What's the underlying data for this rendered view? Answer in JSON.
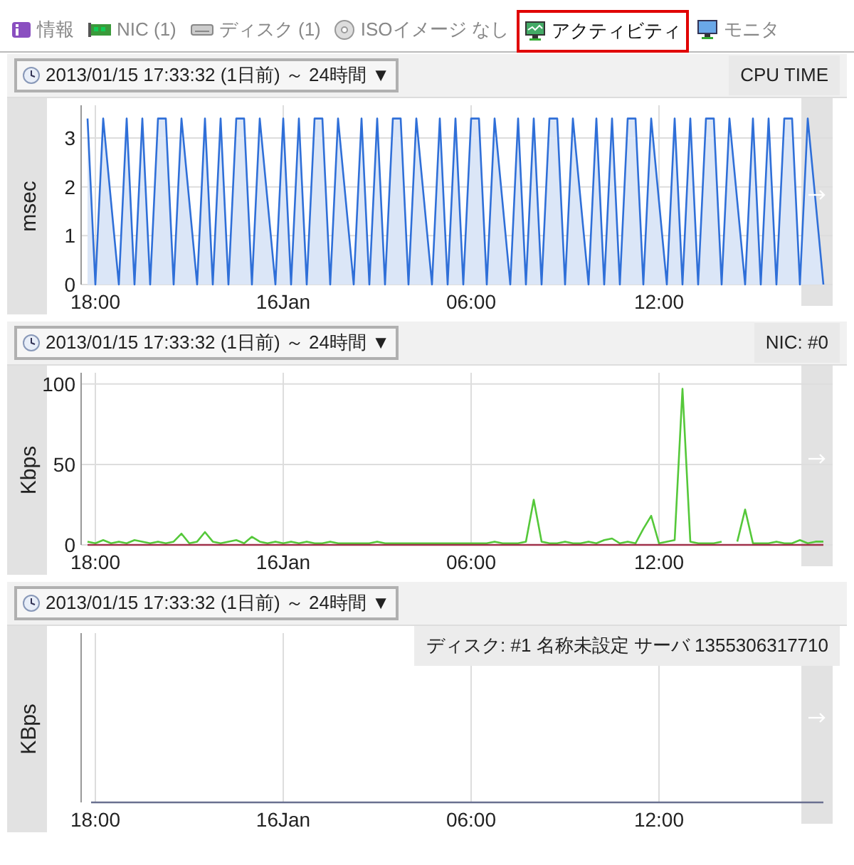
{
  "tabs": [
    {
      "label": "情報",
      "selected": false
    },
    {
      "label": "NIC (1)",
      "selected": false
    },
    {
      "label": "ディスク (1)",
      "selected": false
    },
    {
      "label": "ISOイメージ なし",
      "selected": false
    },
    {
      "label": "アクティビティ",
      "selected": true
    },
    {
      "label": "モニタ",
      "selected": false
    }
  ],
  "panels": [
    {
      "range": "2013/01/15 17:33:32 (1日前) ～ 24時間 ▼",
      "label": "CPU TIME",
      "chart_data": {
        "type": "area",
        "grid": true,
        "ylabel": "msec",
        "ylim": [
          0,
          3.67
        ],
        "yticks": [
          0,
          1,
          2,
          3
        ],
        "categories": [
          null,
          "18:00",
          null,
          null,
          null,
          null,
          null,
          null,
          null,
          null,
          null,
          null,
          null,
          null,
          null,
          null,
          null,
          null,
          null,
          null,
          null,
          null,
          null,
          null,
          null,
          "16Jan",
          null,
          null,
          null,
          null,
          null,
          null,
          null,
          null,
          null,
          null,
          null,
          null,
          null,
          null,
          null,
          null,
          null,
          null,
          null,
          null,
          null,
          null,
          null,
          "06:00",
          null,
          null,
          null,
          null,
          null,
          null,
          null,
          null,
          null,
          null,
          null,
          null,
          null,
          null,
          null,
          null,
          null,
          null,
          null,
          null,
          null,
          null,
          null,
          "12:00",
          null,
          null,
          null,
          null,
          null,
          null,
          null,
          null,
          null,
          null,
          null,
          null,
          null,
          null,
          null,
          null,
          null,
          null,
          null,
          null,
          null
        ],
        "series": [
          {
            "color": "#2f6fd8",
            "values": [
              3.4,
              0,
              3.4,
              1.7,
              0,
              3.4,
              0,
              3.4,
              0,
              3.4,
              3.4,
              0,
              3.4,
              1.7,
              0,
              3.4,
              0,
              3.4,
              0,
              3.4,
              3.4,
              0,
              3.4,
              1.7,
              0,
              3.4,
              0,
              3.4,
              0,
              3.4,
              3.4,
              0,
              3.4,
              1.7,
              0,
              3.4,
              0,
              3.4,
              0,
              3.4,
              3.4,
              0,
              3.4,
              1.7,
              0,
              3.4,
              0,
              3.4,
              0,
              3.4,
              3.4,
              0,
              3.4,
              1.7,
              0,
              3.4,
              0,
              3.4,
              0,
              3.4,
              3.4,
              0,
              3.4,
              1.7,
              0,
              3.4,
              0,
              3.4,
              0,
              3.4,
              3.4,
              0,
              3.4,
              1.7,
              0,
              3.4,
              0,
              3.4,
              0,
              3.4,
              3.4,
              0,
              3.4,
              1.7,
              0,
              3.4,
              0,
              3.4,
              0,
              3.4,
              3.4,
              0,
              3.4,
              1.7,
              0
            ]
          }
        ]
      }
    },
    {
      "range": "2013/01/15 17:33:32 (1日前) ～ 24時間 ▼",
      "label": "NIC: #0",
      "chart_data": {
        "type": "line",
        "grid": true,
        "ylabel": "Kbps",
        "ylim": [
          0,
          107
        ],
        "yticks": [
          0,
          50,
          100
        ],
        "categories": [
          null,
          "18:00",
          null,
          null,
          null,
          null,
          null,
          null,
          null,
          null,
          null,
          null,
          null,
          null,
          null,
          null,
          null,
          null,
          null,
          null,
          null,
          null,
          null,
          null,
          null,
          "16Jan",
          null,
          null,
          null,
          null,
          null,
          null,
          null,
          null,
          null,
          null,
          null,
          null,
          null,
          null,
          null,
          null,
          null,
          null,
          null,
          null,
          null,
          null,
          null,
          "06:00",
          null,
          null,
          null,
          null,
          null,
          null,
          null,
          null,
          null,
          null,
          null,
          null,
          null,
          null,
          null,
          null,
          null,
          null,
          null,
          null,
          null,
          null,
          null,
          "12:00",
          null,
          null,
          null,
          null,
          null,
          null,
          null,
          null,
          null,
          null,
          null,
          null,
          null,
          null,
          null,
          null,
          null,
          null,
          null,
          null,
          null
        ],
        "series": [
          {
            "color": "#55c83a",
            "values": [
              2,
              1,
              3,
              1,
              2,
              1,
              3,
              2,
              1,
              2,
              1,
              2,
              7,
              1,
              2,
              8,
              2,
              1,
              2,
              3,
              1,
              5,
              2,
              1,
              2,
              1,
              2,
              1,
              2,
              1,
              1,
              2,
              1,
              1,
              1,
              1,
              1,
              2,
              1,
              1,
              1,
              1,
              1,
              1,
              1,
              1,
              1,
              1,
              1,
              1,
              1,
              1,
              2,
              1,
              1,
              1,
              2,
              28,
              2,
              1,
              1,
              2,
              1,
              1,
              2,
              1,
              3,
              4,
              1,
              2,
              1,
              10,
              18,
              1,
              2,
              3,
              97,
              2,
              1,
              1,
              1,
              2,
              null,
              2,
              22,
              1,
              1,
              1,
              2,
              1,
              1,
              3,
              1,
              2,
              2
            ]
          },
          {
            "color": "#a0304a",
            "values": [
              0,
              0,
              0,
              0,
              0,
              0,
              0,
              0,
              0,
              0,
              0,
              0,
              0,
              0,
              0,
              0,
              0,
              0,
              0,
              0,
              0,
              0,
              0,
              0,
              0,
              0,
              0,
              0,
              0,
              0,
              0,
              0,
              0,
              0,
              0,
              0,
              0,
              0,
              0,
              0,
              0,
              0,
              0,
              0,
              0,
              0,
              0,
              0,
              0,
              0,
              0,
              0,
              0,
              0,
              0,
              0,
              0,
              0,
              0,
              0,
              0,
              0,
              0,
              0,
              0,
              0,
              0,
              0,
              0,
              0,
              0,
              0,
              0,
              0,
              0,
              0,
              0,
              0,
              0,
              0,
              0,
              0,
              0,
              0,
              0,
              0,
              0,
              0,
              0,
              0,
              0,
              0,
              0,
              0,
              0
            ]
          }
        ]
      }
    },
    {
      "range": "2013/01/15 17:33:32 (1日前) ～ 24時間 ▼",
      "overlay_label": "ディスク: #1 名称未設定 サーバ 1355306317710",
      "plot": {
        "ylabel": "KBps",
        "x_labels": [
          "18:00",
          "16Jan",
          "06:00",
          "12:00"
        ]
      }
    }
  ]
}
